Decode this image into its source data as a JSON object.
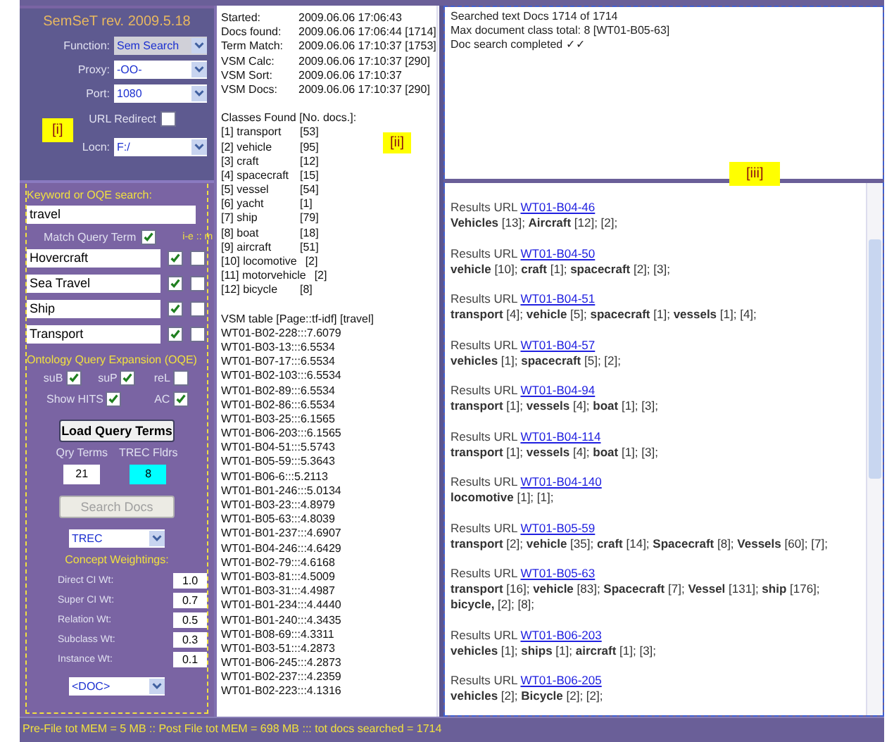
{
  "app_title": "SemSeT rev. 2009.5.18",
  "settings": [
    {
      "label": "Function:",
      "value": "Sem Search",
      "kind": "grey"
    },
    {
      "label": "Proxy:",
      "value": "-OO-",
      "kind": "white"
    },
    {
      "label": "Port:",
      "value": "1080",
      "kind": "white"
    }
  ],
  "panel_labels": [
    "[i]",
    "[ii]",
    "[iii]"
  ],
  "url_redirect": {
    "label": "URL Redirect",
    "checked": false
  },
  "location": {
    "label": "Locn:",
    "value": "F:/"
  },
  "search": {
    "label": "Keyword or OQE search:",
    "value": "travel"
  },
  "match_query_term": {
    "label": "Match Query Term",
    "checked": true
  },
  "column_header": "i-e :: m",
  "terms": [
    {
      "text": "Hovercraft",
      "ie_checked": true,
      "m_checked": false
    },
    {
      "text": "Sea Travel",
      "ie_checked": true,
      "m_checked": false
    },
    {
      "text": "Ship",
      "ie_checked": true,
      "m_checked": false
    },
    {
      "text": "Transport",
      "ie_checked": true,
      "m_checked": false
    }
  ],
  "oqe": {
    "label": "Ontology Query Expansion (OQE)",
    "options": [
      {
        "label": "suB",
        "checked": true
      },
      {
        "label": "suP",
        "checked": true
      },
      {
        "label": "reL",
        "checked": false
      },
      {
        "label": "Show HITS",
        "checked": true
      },
      {
        "label": "AC",
        "checked": true
      }
    ]
  },
  "load_button": "Load Query Terms",
  "counters": [
    {
      "label": "Qry Terms",
      "value": "21",
      "highlighted": false
    },
    {
      "label": "TREC Fldrs",
      "value": "8",
      "highlighted": true
    }
  ],
  "search_button": {
    "label": "Search Docs",
    "disabled": true
  },
  "collection": "TREC",
  "weightings": {
    "label": "Concept Weightings:",
    "items": [
      {
        "label": "Direct CI Wt:",
        "value": "1.0"
      },
      {
        "label": "Super CI Wt:",
        "value": "0.7"
      },
      {
        "label": "Relation Wt:",
        "value": "0.5"
      },
      {
        "label": "Subclass Wt:",
        "value": "0.3"
      },
      {
        "label": "Instance Wt:",
        "value": "0.1"
      }
    ]
  },
  "doc_tag": "<DOC>",
  "log": [
    {
      "label": "Started:",
      "value": "2009.06.06 17:06:43"
    },
    {
      "label": "Docs found:",
      "value": "2009.06.06 17:06:44 [1714]"
    },
    {
      "label": "Term Match:",
      "value": "2009.06.06 17:10:37 [1753]"
    },
    {
      "label": "VSM Calc:",
      "value": "2009.06.06 17:10:37 [290]"
    },
    {
      "label": "VSM Sort:",
      "value": "2009.06.06 17:10:37"
    },
    {
      "label": "VSM Docs:",
      "value": "2009.06.06 17:10:37 [290]"
    }
  ],
  "classes_header": "Classes Found [No. docs.]:",
  "classes": [
    {
      "name": "[1] transport",
      "count": "[53]"
    },
    {
      "name": "[2] vehicle",
      "count": "[95]"
    },
    {
      "name": "[3] craft",
      "count": "[12]"
    },
    {
      "name": "[4] spacecraft",
      "count": "[15]"
    },
    {
      "name": "[5] vessel",
      "count": "[54]"
    },
    {
      "name": "[6] yacht",
      "count": "[1]"
    },
    {
      "name": "[7] ship",
      "count": "[79]"
    },
    {
      "name": "[8] boat",
      "count": "[18]"
    },
    {
      "name": "[9] aircraft",
      "count": "[51]"
    },
    {
      "name": "[10] locomotive",
      "count": "[2]"
    },
    {
      "name": "[11] motorvehicle",
      "count": "[2]"
    },
    {
      "name": "[12] bicycle",
      "count": "[8]"
    }
  ],
  "vsm_header": "VSM table [Page::tf-idf] [travel]",
  "vsm_rows": [
    "WT01-B02-228:::7.6079",
    "WT01-B03-13:::6.5534",
    "WT01-B07-17:::6.5534",
    "WT01-B02-103:::6.5534",
    "WT01-B02-89:::6.5534",
    "WT01-B02-86:::6.5534",
    "WT01-B03-25:::6.1565",
    "WT01-B06-203:::6.1565",
    "WT01-B04-51:::5.5743",
    "WT01-B05-59:::5.3643",
    "WT01-B06-6:::5.2113",
    "WT01-B01-246:::5.0134",
    "WT01-B03-23:::4.8979",
    "WT01-B05-63:::4.8039",
    "WT01-B01-237:::4.6907",
    "WT01-B04-246:::4.6429",
    "WT01-B02-79:::4.6168",
    "WT01-B03-81:::4.5009",
    "WT01-B03-31:::4.4987",
    "WT01-B01-234:::4.4440",
    "WT01-B01-240:::4.3435",
    "WT01-B08-69:::4.3311",
    "WT01-B03-51:::4.2873",
    "WT01-B06-245:::4.2873",
    "WT01-B02-237:::4.2359",
    "WT01-B02-223:::4.1316"
  ],
  "summary": [
    "Searched text Docs 1714 of 1714",
    "Max document class total: 8 [WT01-B05-63]",
    "Doc search completed  ✓✓"
  ],
  "results": [
    {
      "prefix": "Results URL",
      "url": "WT01-B04-46",
      "classes": "**Vehicles** [13]; **Aircraft** [12]; [2];"
    },
    {
      "prefix": "Results URL",
      "url": "WT01-B04-50",
      "classes": "**vehicle** [10]; **craft** [1]; **spacecraft** [2]; [3];"
    },
    {
      "prefix": "Results URL",
      "url": "WT01-B04-51",
      "classes": "**transport** [4]; **vehicle** [5]; **spacecraft** [1]; **vessels** [1]; [4];"
    },
    {
      "prefix": "Results URL",
      "url": "WT01-B04-57",
      "classes": "**vehicles** [1]; **spacecraft** [5]; [2];"
    },
    {
      "prefix": "Results URL",
      "url": "WT01-B04-94",
      "classes": "**transport** [1]; **vessels** [4]; **boat** [1]; [3];"
    },
    {
      "prefix": "Results URL",
      "url": "WT01-B04-114",
      "classes": "**transport** [1]; **vessels** [4]; **boat** [1]; [3];"
    },
    {
      "prefix": "Results URL",
      "url": "WT01-B04-140",
      "classes": "**locomotive** [1]; [1];"
    },
    {
      "prefix": "Results URL",
      "url": "WT01-B05-59",
      "classes": "**transport** [2]; **vehicle** [35]; **craft** [14]; **Spacecraft** [8]; **Vessels** [60]; [7];"
    },
    {
      "prefix": "Results URL",
      "url": "WT01-B05-63",
      "classes": "**transport** [16]; **vehicle** [83]; **Spacecraft** [7]; **Vessel** [131]; **ship** [176]; **bicycle,** [2]; [8];"
    },
    {
      "prefix": "Results URL",
      "url": "WT01-B06-203",
      "classes": "**vehicles** [1]; **ships** [1]; **aircraft** [1]; [3];"
    },
    {
      "prefix": "Results URL",
      "url": "WT01-B06-205",
      "classes": "**vehicles** [2]; **Bicycle** [2]; [2];"
    }
  ],
  "status_bar": "Pre-File tot MEM = 5 MB :: Post File tot MEM = 698 MB ::: tot docs searched = 1714"
}
